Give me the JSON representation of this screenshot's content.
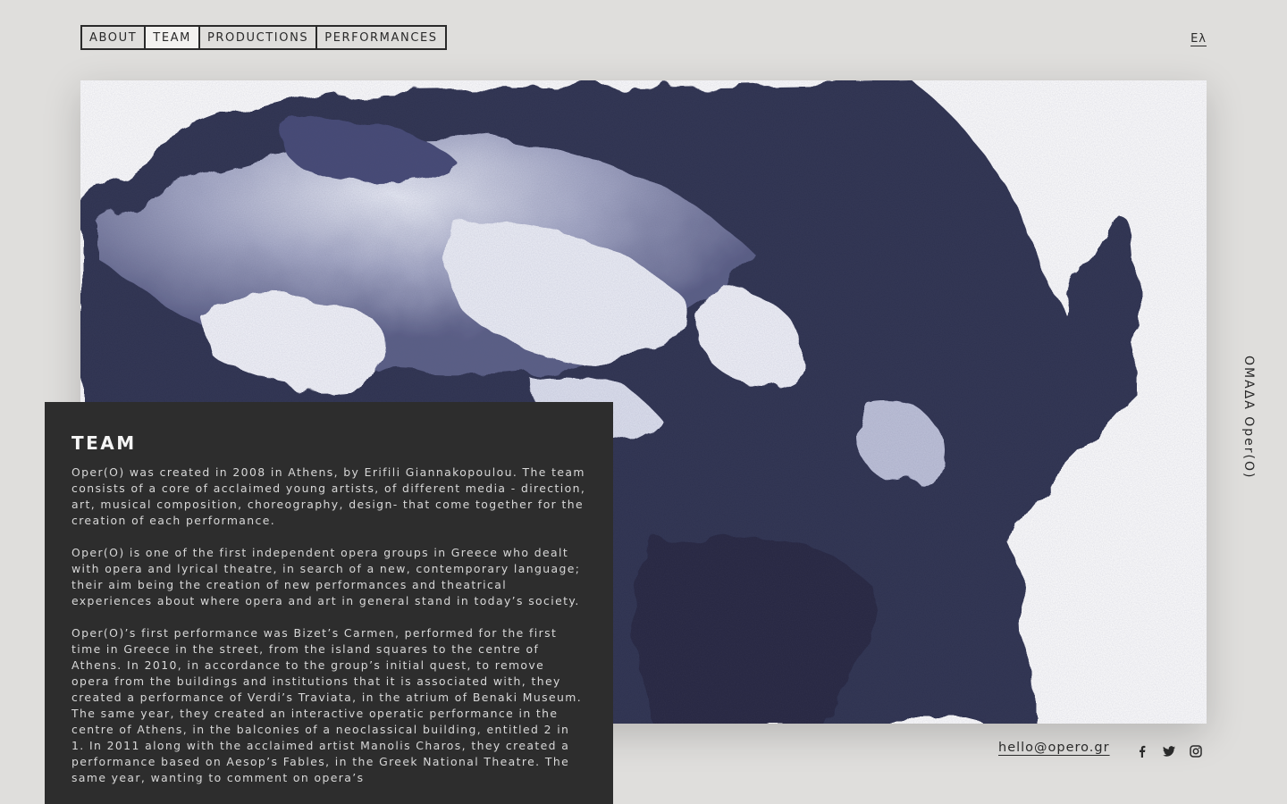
{
  "nav": {
    "items": [
      {
        "label": "ABOUT",
        "active": false
      },
      {
        "label": "TEAM",
        "active": true
      },
      {
        "label": "PRODUCTIONS",
        "active": false
      },
      {
        "label": "PERFORMANCES",
        "active": false
      }
    ]
  },
  "language_toggle": "Ελ",
  "side_label": "ΟΜΑΔΑ Oper(O)",
  "panel": {
    "title": "TEAM",
    "paragraphs": [
      "Oper(O) was created in 2008 in Athens, by Erifili Giannakopoulou. The team consists of a core of acclaimed young artists, of different media - direction, art, musical composition, choreography, design- that come together for the creation of each performance.",
      "Oper(O) is one of the first independent opera groups in Greece who dealt with opera and lyrical theatre, in search of a new, contemporary language; their aim being the creation of new performances and theatrical experiences about where opera and art in general stand in today’s society.",
      "Oper(O)’s first performance was Bizet’s Carmen, performed for the first time in Greece in the street, from the island squares to the centre of Athens. In 2010, in accordance to the group’s initial quest, to remove opera from the buildings and institutions that it is associated with, they created a performance of Verdi’s Traviata, in the atrium of Benaki Museum. The same year, they created an interactive operatic performance in the centre of Athens, in the balconies of a neoclassical building, entitled 2 in 1. In 2011 along with the acclaimed artist Manolis Charos, they created a performance based on Aesop’s Fables, in the Greek National Theatre. The same year, wanting to comment on opera’s"
    ]
  },
  "footer": {
    "email": "hello@opero.gr",
    "socials": [
      "facebook-icon",
      "twitter-icon",
      "instagram-icon"
    ]
  },
  "colors": {
    "background": "#dfdedc",
    "panel": "#2d2d2d",
    "ink": "#2a2a2a",
    "artwork_ink": "#2b2d4a"
  }
}
